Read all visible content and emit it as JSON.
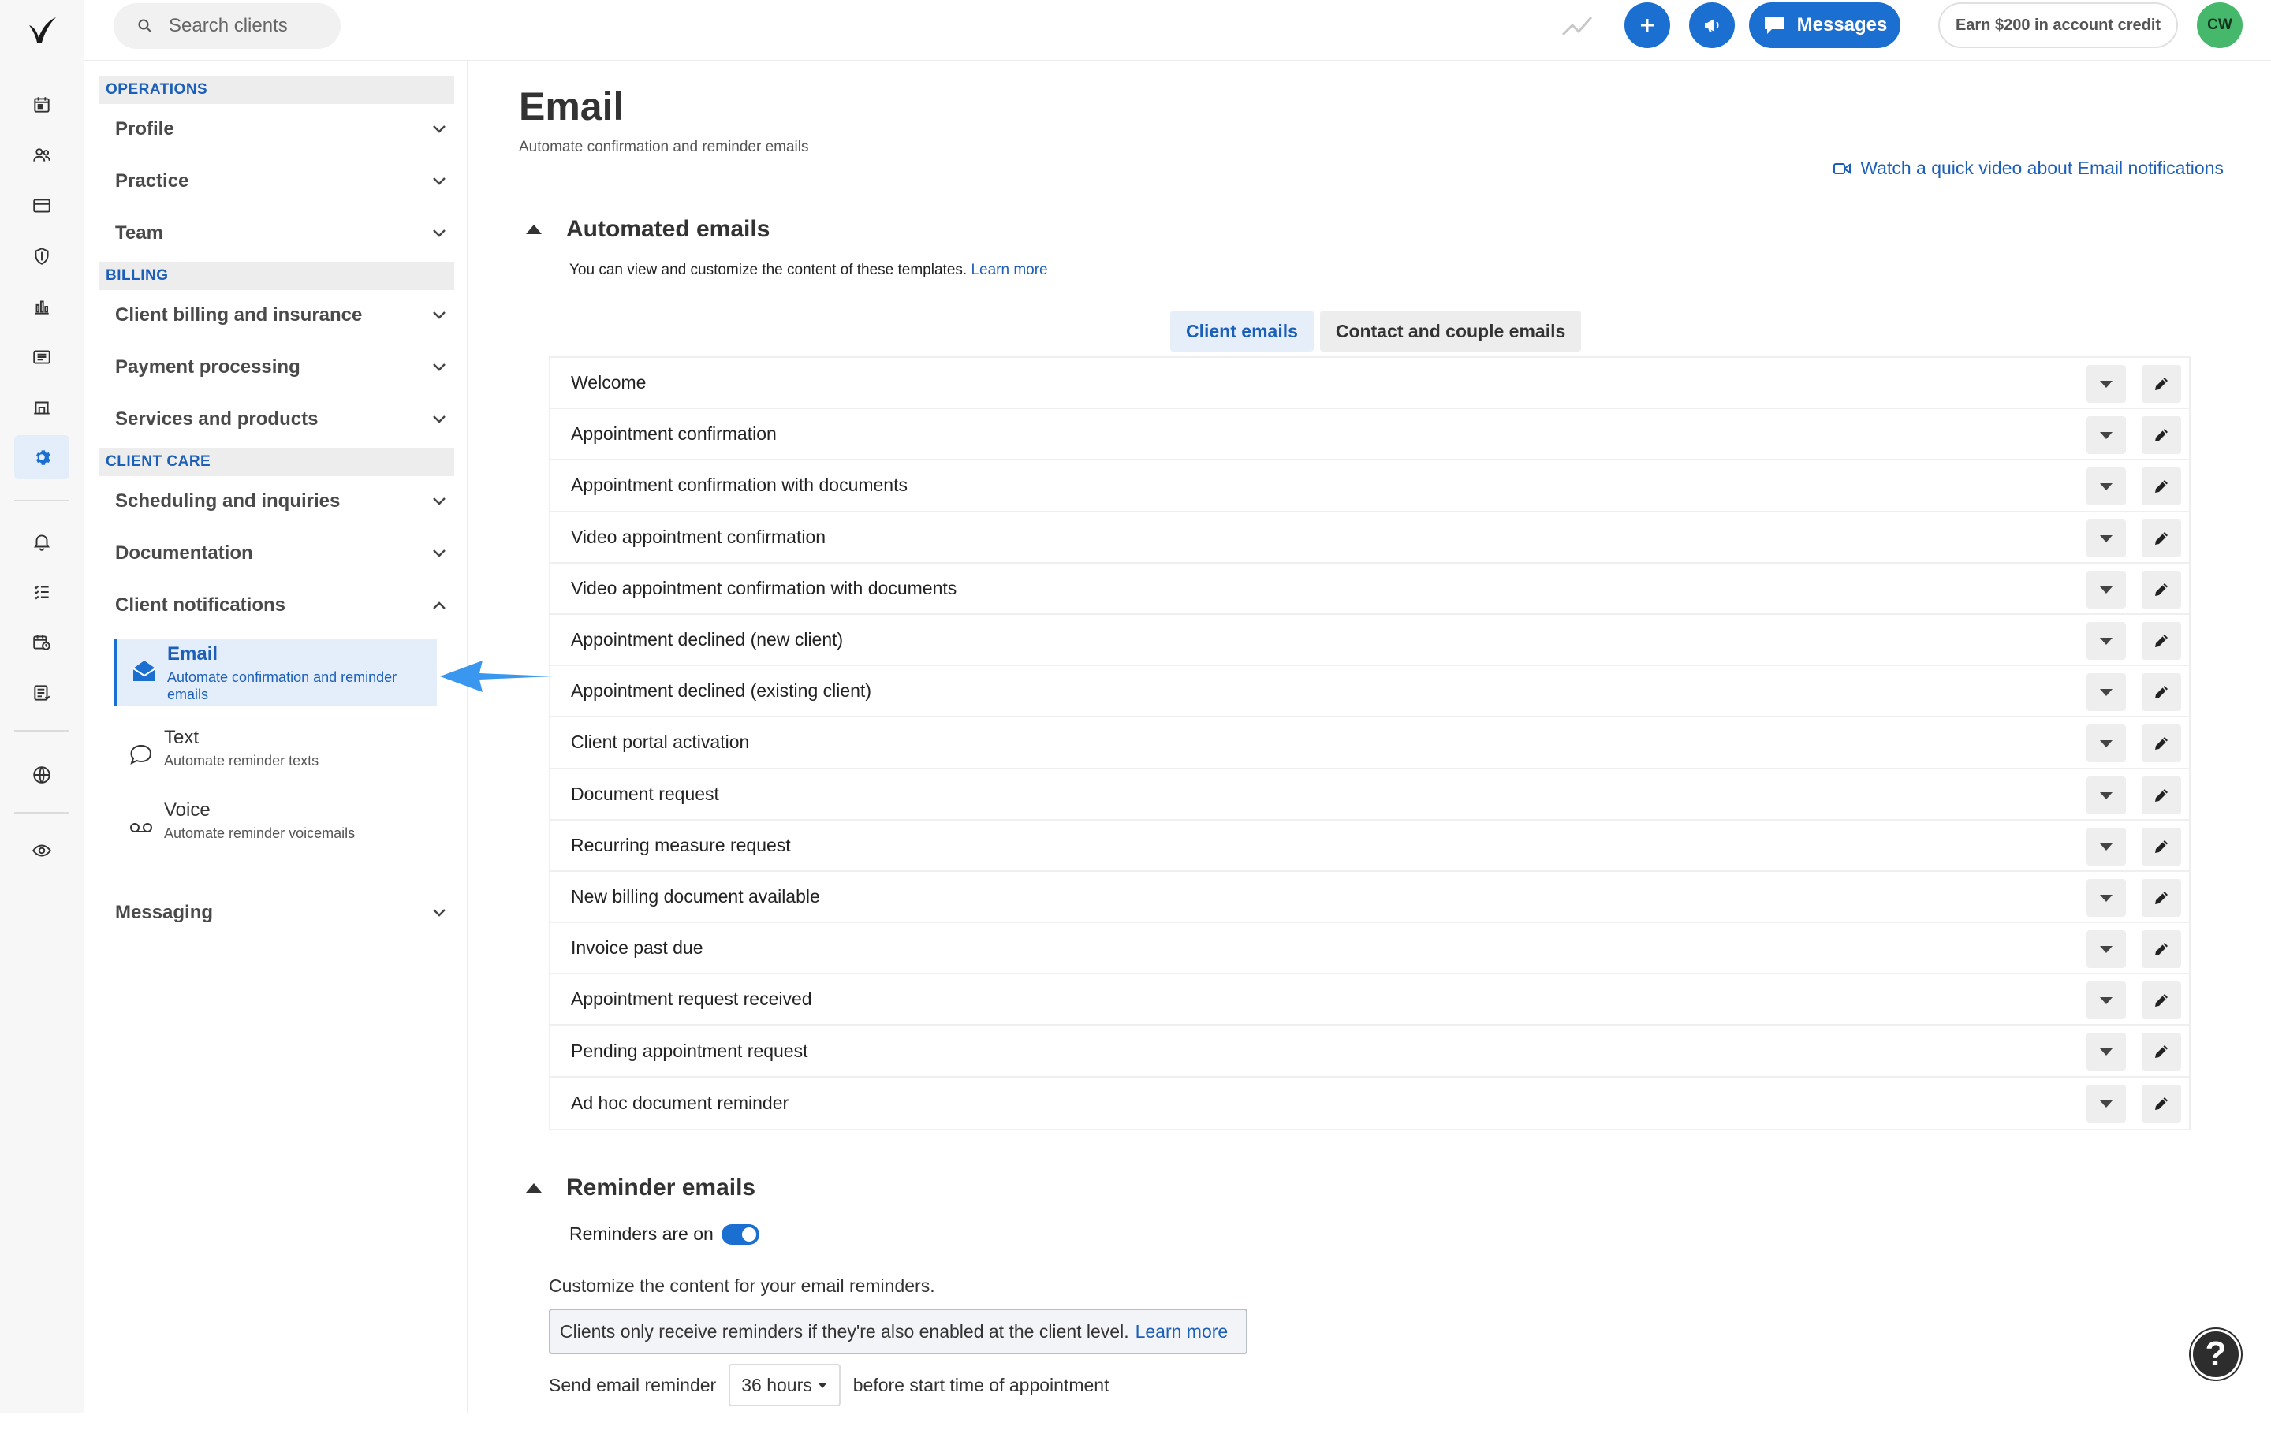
{
  "topbar": {
    "search_placeholder": "Search clients",
    "messages_label": "Messages",
    "earn_label": "Earn $200 in account credit",
    "avatar_initials": "CW",
    "accent_color": "#1b6fd0"
  },
  "sidebar": {
    "sections": {
      "operations": "OPERATIONS",
      "billing": "BILLING",
      "client_care": "CLIENT CARE"
    },
    "items": {
      "profile": "Profile",
      "practice": "Practice",
      "team": "Team",
      "client_billing": "Client billing and insurance",
      "payment_processing": "Payment processing",
      "services_products": "Services and products",
      "scheduling": "Scheduling and inquiries",
      "documentation": "Documentation",
      "client_notifications": "Client notifications",
      "messaging": "Messaging"
    },
    "sub_items": {
      "email": {
        "title": "Email",
        "desc": "Automate confirmation and reminder emails"
      },
      "text": {
        "title": "Text",
        "desc": "Automate reminder texts"
      },
      "voice": {
        "title": "Voice",
        "desc": "Automate reminder voicemails"
      }
    }
  },
  "main": {
    "title": "Email",
    "subtitle": "Automate confirmation and reminder emails",
    "video_link": "Watch a quick video about Email notifications",
    "automated": {
      "heading": "Automated emails",
      "note": "You can view and customize the content of these templates.",
      "learn_more": "Learn more",
      "tabs": [
        "Client emails",
        "Contact and couple emails"
      ],
      "rows": [
        "Welcome",
        "Appointment confirmation",
        "Appointment confirmation with documents",
        "Video appointment confirmation",
        "Video appointment confirmation with documents",
        "Appointment declined (new client)",
        "Appointment declined (existing client)",
        "Client portal activation",
        "Document request",
        "Recurring measure request",
        "New billing document available",
        "Invoice past due",
        "Appointment request received",
        "Pending appointment request",
        "Ad hoc document reminder"
      ]
    },
    "reminders": {
      "heading": "Reminder emails",
      "toggle_label": "Reminders are on",
      "toggle_on": true,
      "customize_text": "Customize the content for your email reminders.",
      "info_text": "Clients only receive reminders if they're also enabled at the client level.",
      "info_link": "Learn more",
      "send_prefix": "Send email reminder",
      "send_value": "36 hours",
      "send_suffix": "before start time of appointment"
    },
    "help_label": "?"
  }
}
